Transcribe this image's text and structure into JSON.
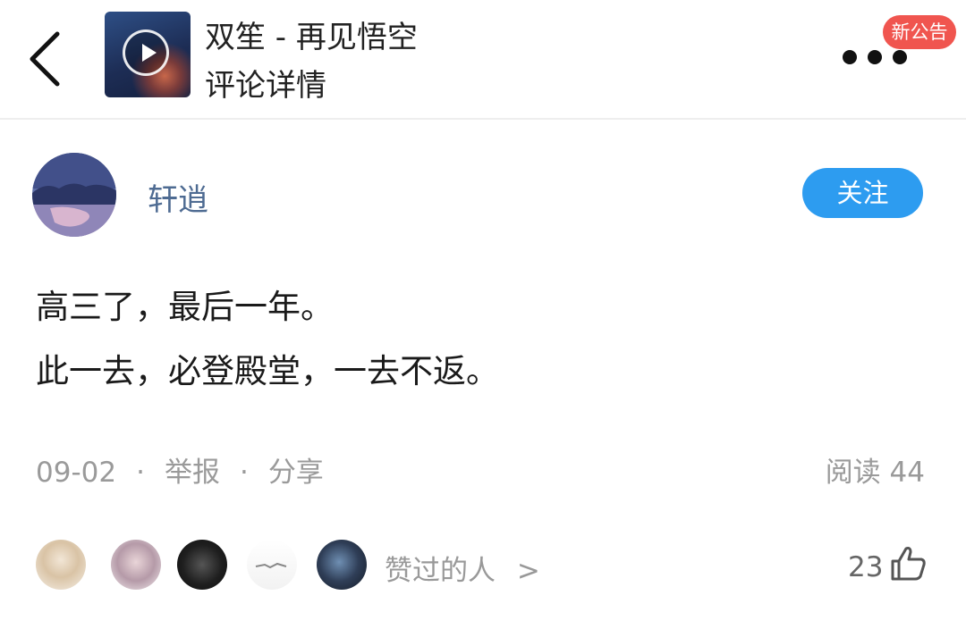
{
  "header": {
    "title": "双笙 - 再见悟空",
    "subtitle": "评论详情",
    "badge": "新公告"
  },
  "comment": {
    "username": "轩逍",
    "follow_label": "关注",
    "lines": [
      "高三了，最后一年。",
      "此一去，必登殿堂，一去不返。"
    ],
    "date": "09-02",
    "sep": "·",
    "report_label": "举报",
    "share_label": "分享",
    "reads_label": "阅读",
    "reads_count": "44",
    "liked_label": "赞过的人",
    "liked_chevron": ">",
    "like_count": "23"
  },
  "icons": [
    "back-arrow-icon",
    "play-icon",
    "more-dots-icon",
    "chevron-right-icon",
    "thumbs-up-icon"
  ],
  "colors": {
    "accent_blue": "#2d9cf0",
    "username": "#4e6b92",
    "badge_red": "#f0554f",
    "meta_gray": "#9a9a9a"
  }
}
